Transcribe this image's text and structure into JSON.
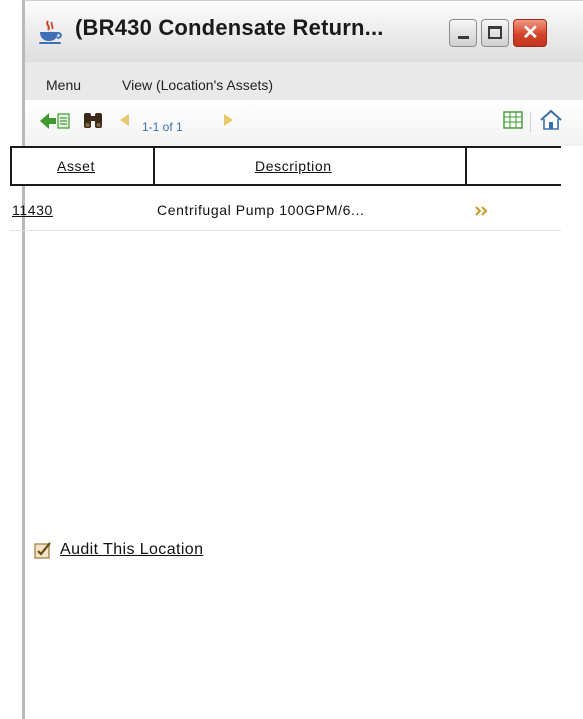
{
  "window": {
    "title": "(BR430 Condensate Return...",
    "buttons": {
      "minimize": "minimize",
      "maximize": "maximize",
      "close": "✕"
    }
  },
  "menu": {
    "items": [
      "Menu",
      "View (Location's Assets)"
    ]
  },
  "toolbar": {
    "pager": "1-1 of 1"
  },
  "table": {
    "headers": [
      "Asset",
      "Description",
      ""
    ],
    "rows": [
      {
        "asset": "11430",
        "description": "Centrifugal Pump 100GPM/6...",
        "action": "»"
      }
    ]
  },
  "audit": {
    "label": "Audit This Location",
    "checked": true
  },
  "colors": {
    "accent_link": "#3a6fb0",
    "close_red": "#d3442a",
    "nav_arrow": "#e0b21a",
    "chevron": "#b98a1a"
  }
}
